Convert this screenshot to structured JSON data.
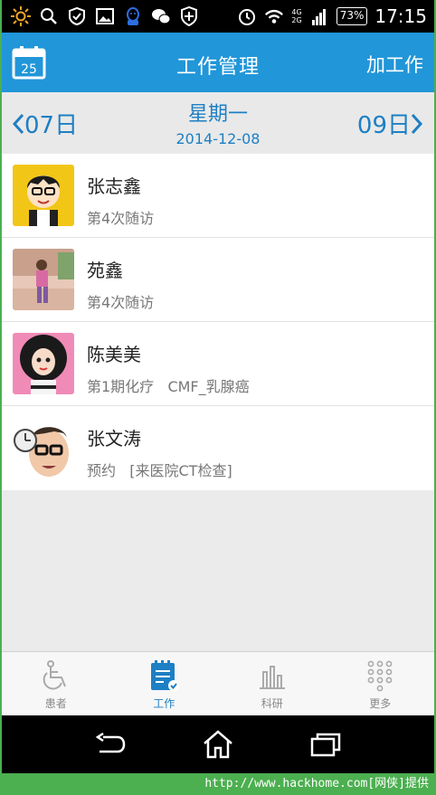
{
  "status_bar": {
    "net_top": "4G",
    "net_bottom": "2G",
    "battery": "73%",
    "time": "17:15",
    "icons_left": [
      "sun-icon",
      "search-icon",
      "shield-check-icon",
      "image-icon",
      "qq-icon",
      "wechat-icon",
      "security-shield-icon"
    ],
    "icons_right": [
      "alarm-icon",
      "wifi-icon",
      "signal-icon",
      "battery-icon"
    ]
  },
  "header": {
    "calendar_day": "25",
    "title": "工作管理",
    "action_label": "加工作"
  },
  "date_nav": {
    "prev_label": "07日",
    "weekday": "星期一",
    "date": "2014-12-08",
    "next_label": "09日"
  },
  "patients": [
    {
      "name": "张志鑫",
      "note": "第4次随访"
    },
    {
      "name": "苑鑫",
      "note": "第4次随访"
    },
    {
      "name": "陈美美",
      "note": "第1期化疗   CMF_乳腺癌"
    },
    {
      "name": "张文涛",
      "note": "预约   [来医院CT检查]"
    }
  ],
  "tabs": [
    {
      "label": "患者",
      "icon": "wheelchair-icon",
      "active": false
    },
    {
      "label": "工作",
      "icon": "notepad-check-icon",
      "active": true
    },
    {
      "label": "科研",
      "icon": "bar-chart-icon",
      "active": false
    },
    {
      "label": "更多",
      "icon": "dots-grid-icon",
      "active": false
    }
  ],
  "colors": {
    "accent": "#2196d9",
    "link": "#1d7fc4",
    "background": "#ebebeb"
  },
  "watermark": "http://www.hackhome.com[网侠]提供"
}
